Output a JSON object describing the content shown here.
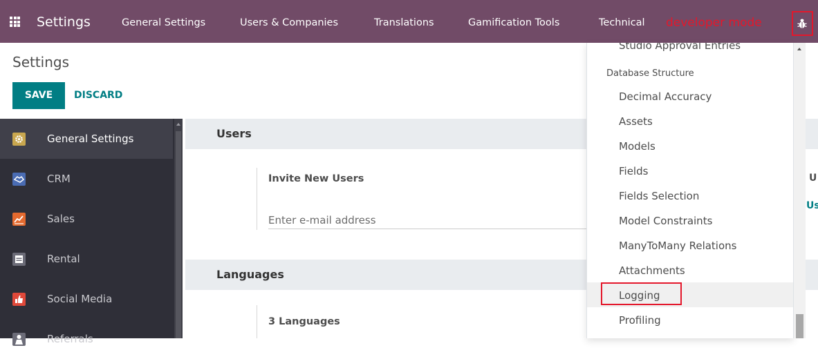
{
  "topbar": {
    "app_name": "Settings",
    "menu": [
      "General Settings",
      "Users & Companies",
      "Translations",
      "Gamification Tools",
      "Technical"
    ],
    "developer_mode_label": "developer mode",
    "icons": {
      "apps": "apps-grid-icon",
      "debug": "bug-icon"
    },
    "colors": {
      "background": "#714b67",
      "developer_mode": "#e4172b"
    }
  },
  "control_panel": {
    "title": "Settings",
    "save_label": "SAVE",
    "discard_label": "DISCARD",
    "accent_color": "#017e84"
  },
  "sidebar": {
    "items": [
      {
        "label": "General Settings",
        "icon": "gear-icon",
        "active": true,
        "color": "#c9a74f"
      },
      {
        "label": "CRM",
        "icon": "handshake-icon",
        "active": false,
        "color": "#4a6cb3"
      },
      {
        "label": "Sales",
        "icon": "chart-icon",
        "active": false,
        "color": "#e46a2f"
      },
      {
        "label": "Rental",
        "icon": "calendar-icon",
        "active": false,
        "color": "#6c6c78"
      },
      {
        "label": "Social Media",
        "icon": "thumbs-up-icon",
        "active": false,
        "color": "#e0493a"
      },
      {
        "label": "Referrals",
        "icon": "person-icon",
        "active": false,
        "color": "#6c6c78"
      }
    ]
  },
  "main": {
    "users_section": {
      "title": "Users",
      "invite_label": "Invite New Users",
      "email_placeholder": "Enter e-mail address",
      "right_text_1": "U",
      "right_text_2": "Us"
    },
    "languages_section": {
      "title": "Languages",
      "count_label": "3 Languages"
    }
  },
  "technical_dropdown": {
    "top_item": "Studio Approval Entries",
    "group_header": "Database Structure",
    "items": [
      "Decimal Accuracy",
      "Assets",
      "Models",
      "Fields",
      "Fields Selection",
      "Model Constraints",
      "ManyToMany Relations",
      "Attachments",
      "Logging",
      "Profiling"
    ],
    "hovered_item": "Logging"
  }
}
